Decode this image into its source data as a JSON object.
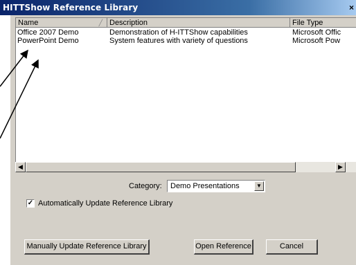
{
  "window": {
    "title": "HITTShow Reference Library"
  },
  "list": {
    "columns": [
      "Name",
      "Description",
      "File Type"
    ],
    "rows": [
      {
        "name": "Office 2007 Demo",
        "description": "Demonstration of H-ITTShow capabilities",
        "file_type": "Microsoft Offic"
      },
      {
        "name": "PowerPoint Demo",
        "description": "System features with variety of questions",
        "file_type": "Microsoft Pow"
      }
    ]
  },
  "category": {
    "label": "Category:",
    "value": "Demo Presentations"
  },
  "auto_update": {
    "label": "Automatically Update Reference Library",
    "checked": true
  },
  "buttons": {
    "manual_update": "Manually Update Reference Library",
    "open": "Open Reference",
    "cancel": "Cancel"
  },
  "icons": {
    "close": "close-icon",
    "sort": "sort-icon",
    "scroll_left": "arrow-left-icon",
    "scroll_right": "arrow-right-icon",
    "dropdown": "chevron-down-icon",
    "check": "check-icon"
  },
  "colors": {
    "titlebar": "#0a246a",
    "dialog_bg": "#d4d0c8"
  }
}
